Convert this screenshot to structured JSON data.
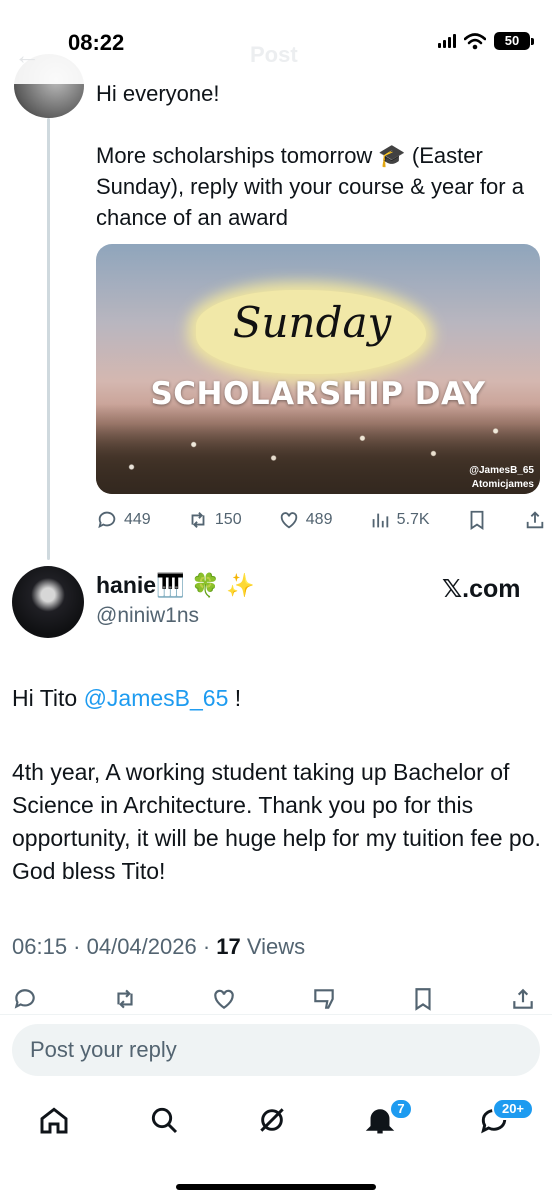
{
  "status_bar": {
    "time": "08:22",
    "battery": "50"
  },
  "header": {
    "title": "Post"
  },
  "parent_tweet": {
    "line1": "Hi everyone!",
    "line2": "More scholarships tomorrow 🎓 (Easter Sunday), reply with your course & year for a chance of an award",
    "media": {
      "script_text": "Sunday",
      "headline": "SCHOLARSHIP DAY",
      "watermark1": "@JamesB_65",
      "watermark2": "Atomicjames"
    },
    "stats": {
      "replies": "449",
      "reposts": "150",
      "likes": "489",
      "views": "5.7K"
    }
  },
  "reply_tweet": {
    "name": "hanie🎹 🍀 ✨",
    "handle": "@niniw1ns",
    "source": "𝕏.com",
    "greeting_prefix": "Hi Tito ",
    "mention": "@JamesB_65",
    "greeting_suffix": " !",
    "body": "4th year, A working student taking up Bachelor of Science in Architecture. Thank you po for this opportunity, it will be huge help for my tuition fee po. God bless Tito!",
    "timestamp": "06:15 · 04/04/2026 · ",
    "views_count": "17",
    "views_label": " Views"
  },
  "reply_composer": {
    "placeholder": "Post your reply"
  },
  "tabbar": {
    "notifications_badge": "7",
    "messages_badge": "20+"
  },
  "colors": {
    "accent": "#1d9bf0",
    "text": "#0f1419",
    "muted": "#536471"
  }
}
